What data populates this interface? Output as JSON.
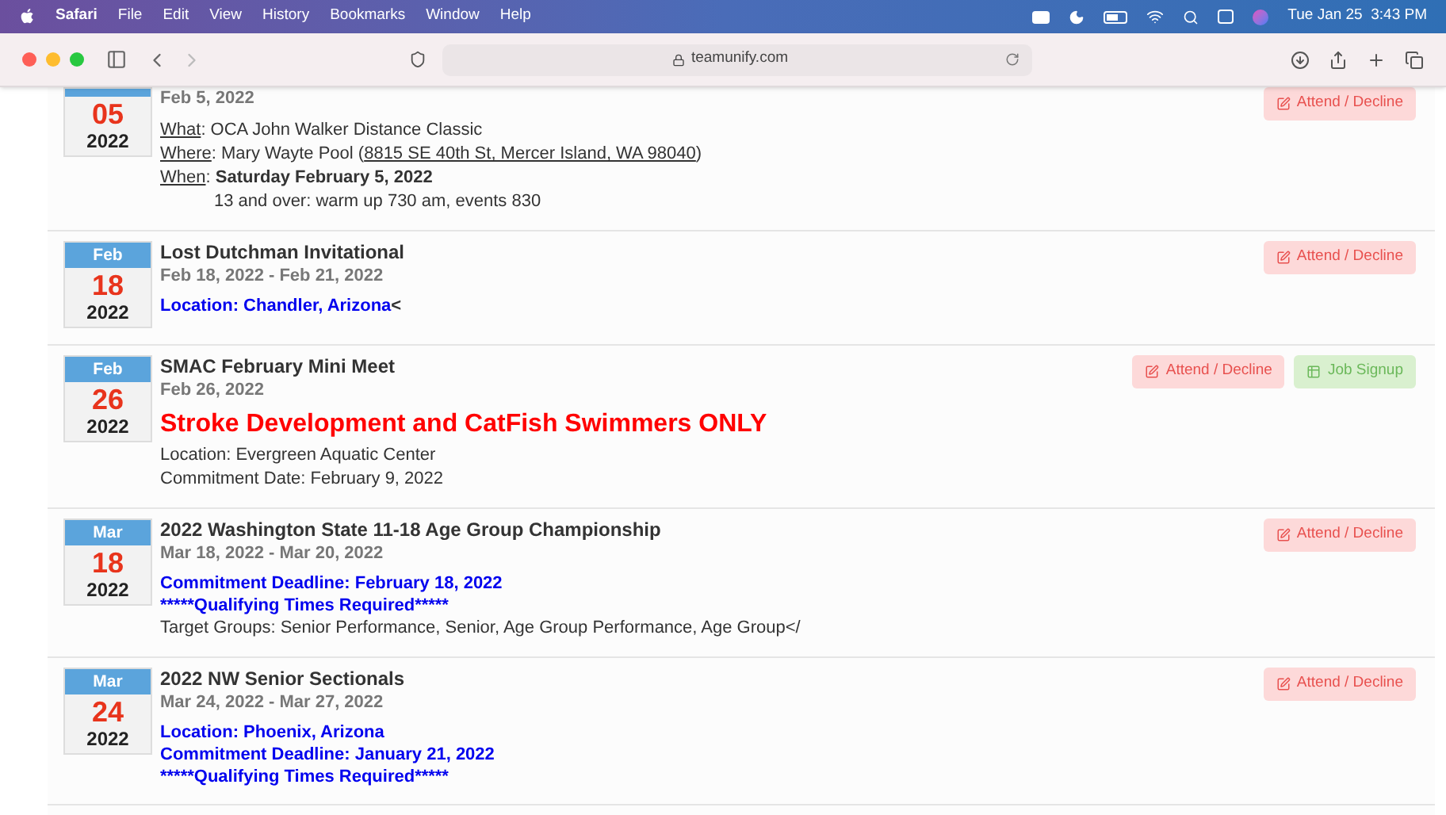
{
  "menu_bar": {
    "app": "Safari",
    "items": [
      "File",
      "Edit",
      "View",
      "History",
      "Bookmarks",
      "Window",
      "Help"
    ],
    "clock": "Tue Jan 25  3:43 PM"
  },
  "toolbar": {
    "address": "teamunify.com"
  },
  "events": [
    {
      "top_cut": true,
      "day": "05",
      "year": "2022",
      "dates": "Feb 5, 2022",
      "lines": [
        {
          "kind": "field",
          "label": "What",
          "value": ": OCA John Walker Distance Classic"
        },
        {
          "kind": "field",
          "label": "Where",
          "value": ": Mary Wayte Pool (",
          "link": "8815 SE 40th St, Mercer Island, WA 98040",
          "after": ")"
        },
        {
          "kind": "field",
          "label": "When",
          "value": ": **Saturday February 5, 2022**"
        },
        {
          "kind": "indent",
          "text": "13 and over: warm up 730 am, events 830"
        }
      ],
      "buttons": [
        {
          "kind": "attend",
          "label": "Attend / Decline"
        }
      ]
    },
    {
      "top_cut": false,
      "month": "Feb",
      "day": "18",
      "year": "2022",
      "title": "Lost Dutchman Invitational",
      "dates": "Feb 18, 2022 - Feb 21, 2022",
      "lines": [
        {
          "kind": "blue",
          "text": "Location:  Chandler, Arizona",
          "tail": "<"
        }
      ],
      "buttons": [
        {
          "kind": "attend",
          "label": "Attend / Decline"
        }
      ]
    },
    {
      "top_cut": false,
      "month": "Feb",
      "day": "26",
      "year": "2022",
      "title": "SMAC February Mini Meet",
      "dates": "Feb 26, 2022",
      "lines": [
        {
          "kind": "headline",
          "text": "Stroke Development and CatFish Swimmers ONLY"
        },
        {
          "kind": "plain",
          "text": "Location:  Evergreen Aquatic Center"
        },
        {
          "kind": "plain",
          "text": "Commitment Date:  February 9, 2022"
        }
      ],
      "buttons": [
        {
          "kind": "attend",
          "label": "Attend / Decline"
        },
        {
          "kind": "job",
          "label": "Job Signup"
        }
      ]
    },
    {
      "top_cut": false,
      "month": "Mar",
      "day": "18",
      "year": "2022",
      "title": "2022 Washington State 11-18 Age Group Championship",
      "dates": "Mar 18, 2022 - Mar 20, 2022",
      "lines": [
        {
          "kind": "blue",
          "text": "Commitment Deadline:  February 18, 2022"
        },
        {
          "kind": "blue",
          "text": "*****Qualifying Times Required*****"
        },
        {
          "kind": "plain",
          "text": "Target Groups:  Senior Performance, Senior, Age Group Performance, Age Group</"
        }
      ],
      "buttons": [
        {
          "kind": "attend",
          "label": "Attend / Decline"
        }
      ]
    },
    {
      "top_cut": false,
      "month": "Mar",
      "day": "24",
      "year": "2022",
      "title": "2022 NW Senior Sectionals",
      "dates": "Mar 24, 2022 - Mar 27, 2022",
      "lines": [
        {
          "kind": "blue",
          "text": "Location:  Phoenix, Arizona"
        },
        {
          "kind": "blue",
          "text": "Commitment Deadline:  January 21, 2022"
        },
        {
          "kind": "blue",
          "text": "*****Qualifying Times Required*****"
        }
      ],
      "buttons": [
        {
          "kind": "attend",
          "label": "Attend / Decline"
        }
      ]
    }
  ]
}
